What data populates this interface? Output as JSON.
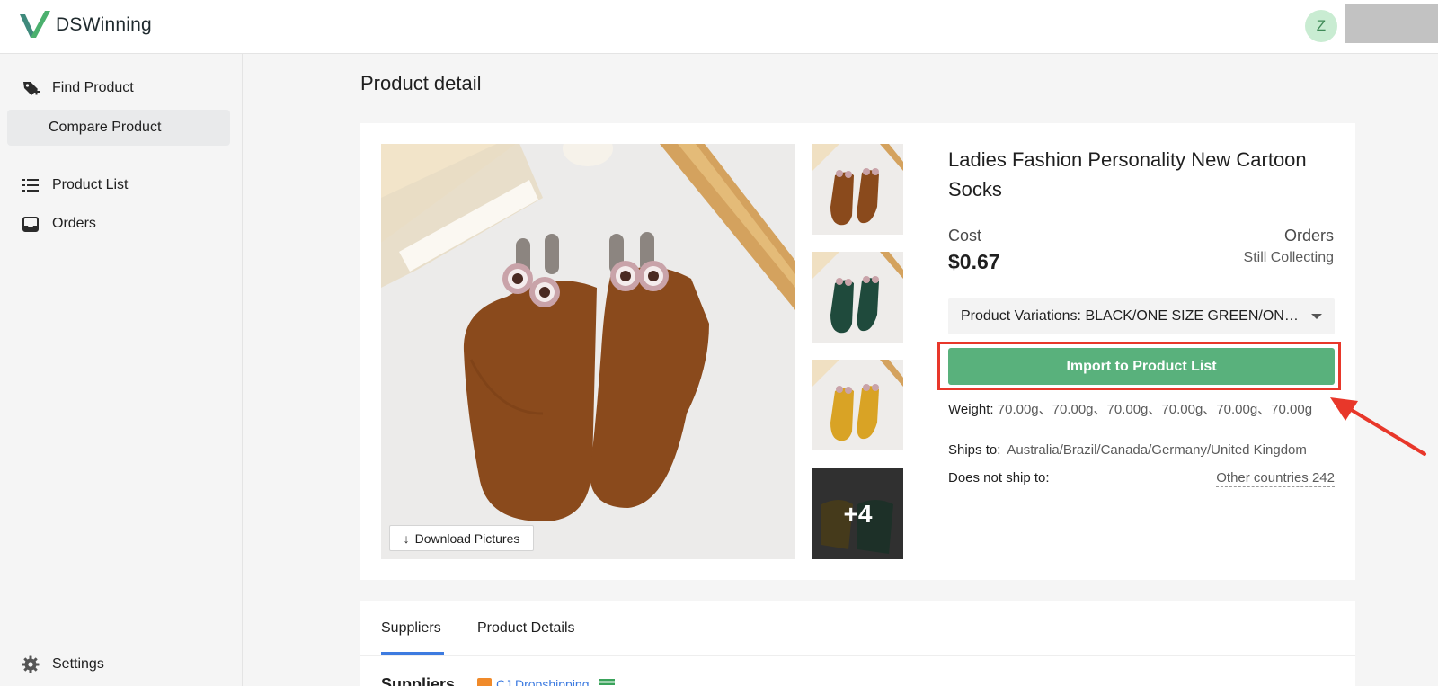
{
  "app": {
    "name": "DSWinning"
  },
  "user": {
    "initial": "Z"
  },
  "sidebar": {
    "items": [
      {
        "label": "Find Product",
        "icon": "tag-plus-icon"
      },
      {
        "label": "Compare Product",
        "icon": ""
      },
      {
        "label": "Product List",
        "icon": "list-icon"
      },
      {
        "label": "Orders",
        "icon": "inbox-icon"
      }
    ],
    "settings_label": "Settings"
  },
  "page": {
    "title": "Product detail"
  },
  "product": {
    "title": "Ladies Fashion Personality New Cartoon Socks",
    "cost_label": "Cost",
    "cost_value": "$0.67",
    "orders_label": "Orders",
    "orders_value": "Still Collecting",
    "variation_text": "Product Variations: BLACK/ONE SIZE GREEN/ONE SIZE",
    "import_label": "Import to Product List",
    "weight_label": "Weight:",
    "weight_value": "70.00g、70.00g、70.00g、70.00g、70.00g、70.00g",
    "ships_label": "Ships to:",
    "ships_value": "Australia/Brazil/Canada/Germany/United Kingdom",
    "noship_label": "Does not ship to:",
    "noship_value": "Other countries 242",
    "download_label": "Download Pictures",
    "more_images": "+4",
    "colors": {
      "accent_green": "#59b17c",
      "highlight_red": "#e8372a",
      "link_blue": "#3d7be0"
    }
  },
  "tabs": [
    {
      "label": "Suppliers",
      "active": true
    },
    {
      "label": "Product Details",
      "active": false
    }
  ],
  "suppliers": {
    "heading": "Suppliers",
    "name": "CJ Dropshipping"
  }
}
